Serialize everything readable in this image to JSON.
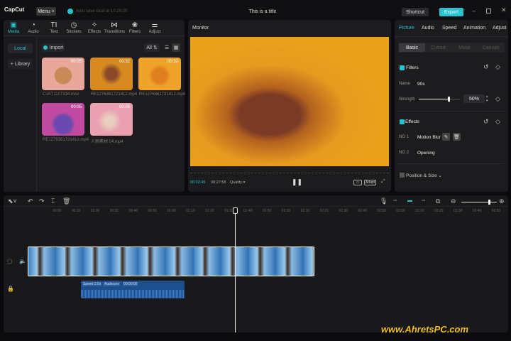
{
  "app": {
    "logo": "CapCut",
    "menu": "Menu",
    "autosave": "Auto save local at 10:20:20",
    "title": "This is a title",
    "shortcut": "Shortcut",
    "export": "Export",
    "accent": "#22c5cf"
  },
  "toolbar": {
    "tabs": [
      {
        "label": "Media",
        "icon": "media-icon"
      },
      {
        "label": "Audio",
        "icon": "audio-icon"
      },
      {
        "label": "Text",
        "icon": "text-icon"
      },
      {
        "label": "Stickers",
        "icon": "stickers-icon"
      },
      {
        "label": "Effects",
        "icon": "effects-icon"
      },
      {
        "label": "Transitions",
        "icon": "transitions-icon"
      },
      {
        "label": "Filters",
        "icon": "filters-icon"
      },
      {
        "label": "Adjust",
        "icon": "adjust-icon"
      }
    ]
  },
  "media": {
    "sidebar": [
      "Local",
      "+ Library"
    ],
    "import": "Import",
    "filter": "All",
    "items": [
      {
        "name": "C1ST1107334.mov",
        "duration": "00:05"
      },
      {
        "name": "RE1276361721412.mp4",
        "duration": "00:32"
      },
      {
        "name": "RE1276361721412.mp4",
        "duration": "00:32"
      },
      {
        "name": "RE1276361721412.mp4",
        "duration": "00:05"
      },
      {
        "name": "人物素材 04.mp4",
        "duration": "00:05"
      }
    ]
  },
  "monitor": {
    "title": "Monitor",
    "current": "00:02:45",
    "total": "00:27:58",
    "quality": "Quality",
    "ratio": "Adapt"
  },
  "inspector": {
    "tabs": [
      "Picture",
      "Audio",
      "Speed",
      "Animation",
      "Adjust"
    ],
    "subtabs": [
      "Basic",
      "Cutout",
      "Mask",
      "Canvas"
    ],
    "filters": {
      "title": "Filters",
      "name_label": "Name",
      "name": "90s",
      "strength_label": "Strength",
      "strength": "50%",
      "strength_value": 0.5
    },
    "effects": {
      "title": "Effects",
      "items": [
        {
          "no": "NO 1",
          "name": "Motion Blur"
        },
        {
          "no": "NO 2",
          "name": "Opening"
        }
      ]
    },
    "position": {
      "title": "Position & Size"
    }
  },
  "timeline": {
    "ticks": [
      "00:00",
      "00:10",
      "00:20",
      "00:30",
      "00:40",
      "00:50",
      "01:00",
      "01:10",
      "01:20",
      "01:30",
      "01:40",
      "01:50",
      "02:00",
      "02:10",
      "02:20",
      "02:30",
      "02:40",
      "02:50",
      "03:00",
      "03:10",
      "03:20",
      "03:30",
      "03:40",
      "03:50"
    ],
    "audio_clip": {
      "speed": "Speed 2.0x",
      "name": "Audioceo",
      "time": "00:00:00"
    },
    "zoom": 0.75
  },
  "watermark": "www.AhretsPC.com"
}
